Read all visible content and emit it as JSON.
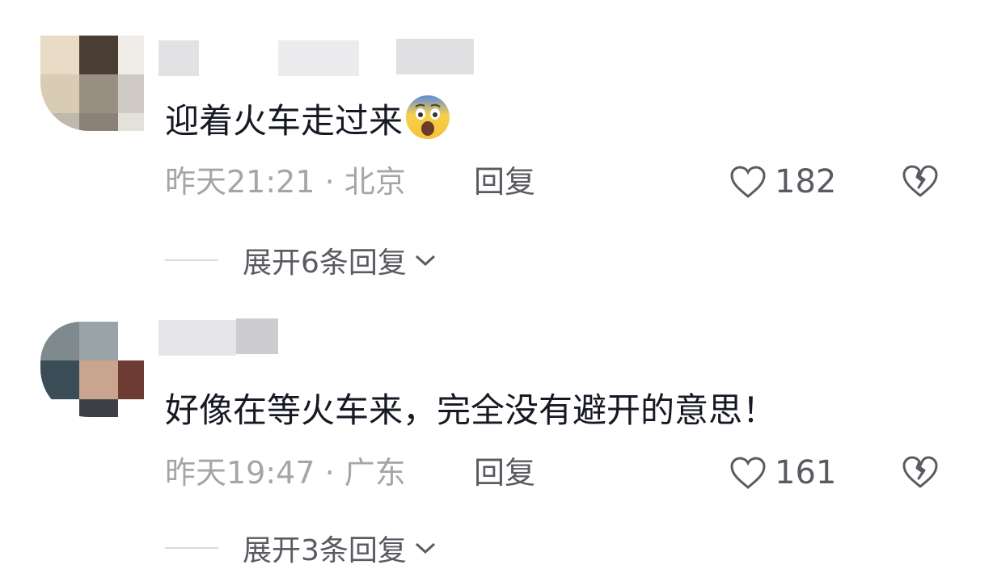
{
  "comments": [
    {
      "text": "迎着火车走过来",
      "emoji": "fearful-face-emoji",
      "time_location": "昨天21:21 · 北京",
      "reply_label": "回复",
      "like_count": "182",
      "expand_label": "展开6条回复"
    },
    {
      "text": "好像在等火车来，完全没有避开的意思！",
      "time_location": "昨天19:47 · 广东",
      "reply_label": "回复",
      "like_count": "161",
      "expand_label": "展开3条回复"
    }
  ],
  "colors": {
    "primary_text": "#161823",
    "secondary_text": "#a4a5a9",
    "action_text": "#5a5b62"
  }
}
